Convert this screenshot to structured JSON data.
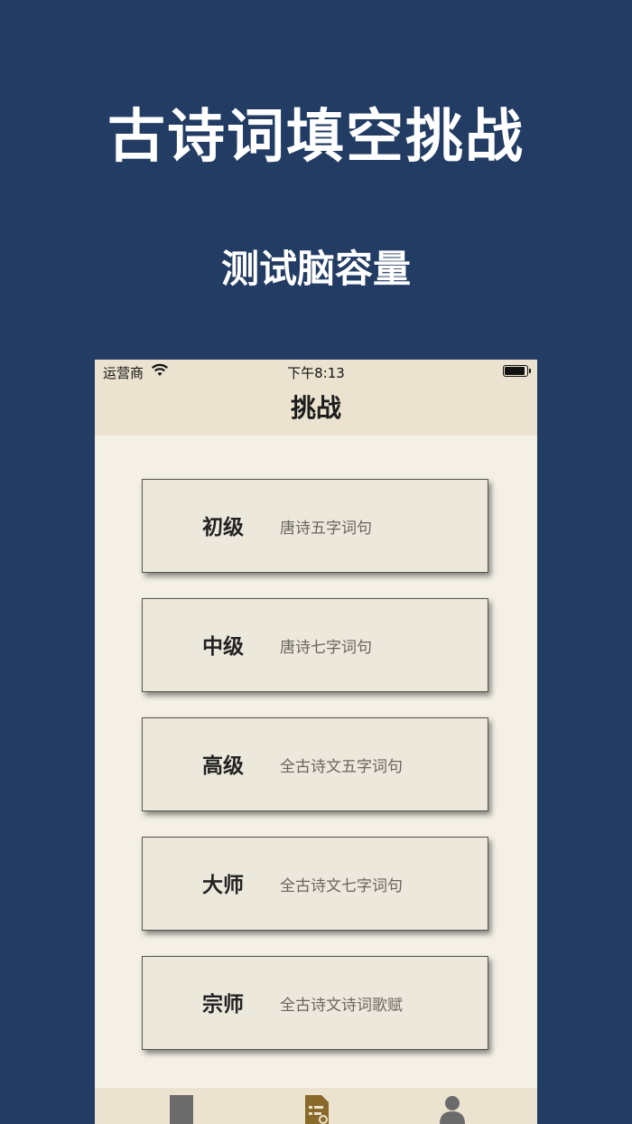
{
  "promo": {
    "title": "古诗词填空挑战",
    "subtitle": "测试脑容量"
  },
  "status_bar": {
    "carrier": "运营商",
    "time": "下午8:13"
  },
  "nav": {
    "title": "挑战"
  },
  "levels": [
    {
      "name": "初级",
      "desc": "唐诗五字词句"
    },
    {
      "name": "中级",
      "desc": "唐诗七字词句"
    },
    {
      "name": "高级",
      "desc": "全古诗文五字词句"
    },
    {
      "name": "大师",
      "desc": "全古诗文七字词句"
    },
    {
      "name": "宗师",
      "desc": "全古诗文诗词歌赋"
    }
  ],
  "tabs": [
    {
      "icon": "book-icon",
      "active": false
    },
    {
      "icon": "challenge-list-icon",
      "active": true
    },
    {
      "icon": "person-icon",
      "active": false
    }
  ],
  "colors": {
    "background": "#223c63",
    "app_bar": "#ebe3cf",
    "content_bg": "#f4f0e6",
    "card_bg": "#ede8dc",
    "tab_active": "#8a6a2a",
    "tab_inactive": "#6b6b6b"
  }
}
